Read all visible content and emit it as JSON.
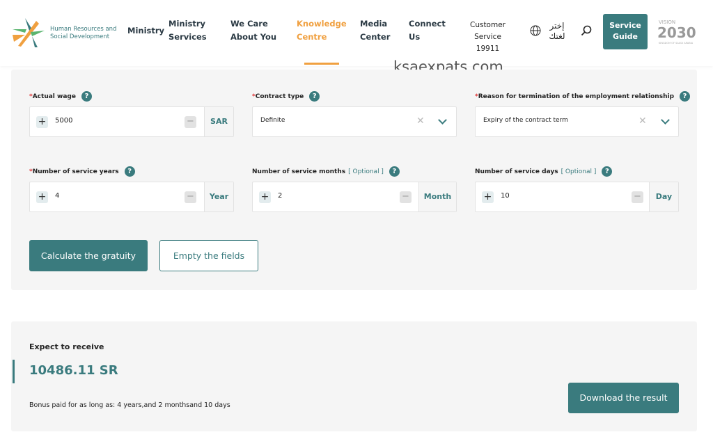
{
  "header": {
    "logo_text": [
      "Human Resources and",
      "Social Development"
    ],
    "nav": [
      {
        "label": "Ministry",
        "active": false
      },
      {
        "label": "Ministry Services",
        "active": false
      },
      {
        "label": "We Care About You",
        "active": false
      },
      {
        "label": "Knowledge Centre",
        "active": true
      },
      {
        "label": "Media Center",
        "active": false
      },
      {
        "label": "Connect Us",
        "active": false
      },
      {
        "label": "Customer Service 19911",
        "active": false
      }
    ],
    "language": "إختر لغتك",
    "service_guide": "Service Guide",
    "vision_logo": "VISION 2030 KINGDOM OF SAUDI ARABIA"
  },
  "watermark": "ksaexpats.com",
  "form": {
    "actual_wage": {
      "label": "Actual wage",
      "required": "*",
      "value": "5000",
      "unit": "SAR"
    },
    "contract_type": {
      "label": "Contract type",
      "required": "*",
      "value": "Definite"
    },
    "termination_reason": {
      "label": "Reason for termination of the employment relationship",
      "required": "*",
      "value": "Expiry of the contract term"
    },
    "service_years": {
      "label": "Number of service years",
      "required": "*",
      "value": "4",
      "unit": "Year"
    },
    "service_months": {
      "label": "Number of service months",
      "optional": "[ Optional ]",
      "value": "2",
      "unit": "Month"
    },
    "service_days": {
      "label": "Number of service days",
      "optional": "[ Optional ]",
      "value": "10",
      "unit": "Day"
    },
    "calculate": "Calculate the gratuity",
    "empty": "Empty the fields"
  },
  "result": {
    "title": "Expect to receive",
    "amount": "10486.11 SR",
    "bonus": "Bonus paid for as long as: 4 years,and 2 monthsand 10 days",
    "download": "Download the result"
  },
  "colors": {
    "accent": "#3a7b7e",
    "active_nav": "#f0a040"
  }
}
